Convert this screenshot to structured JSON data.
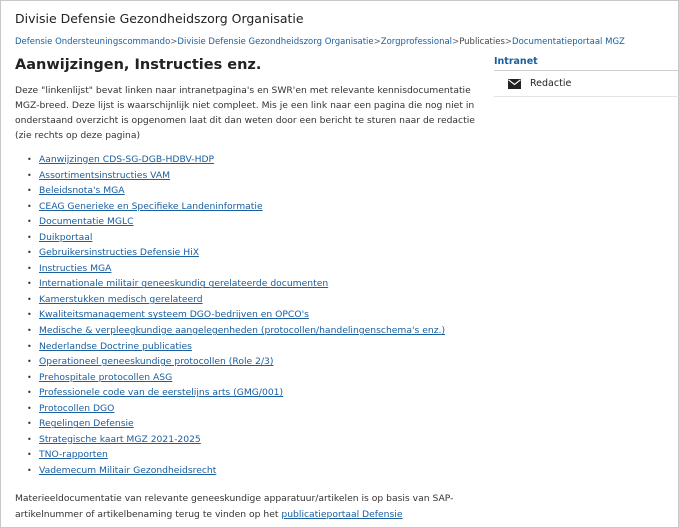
{
  "header": {
    "site_title": "Divisie Defensie Gezondheidszorg Organisatie"
  },
  "breadcrumb": {
    "items": [
      {
        "label": "Defensie Ondersteuningscommando"
      },
      {
        "label": "Divisie Defensie Gezondheidszorg Organisatie"
      },
      {
        "label": "Zorgprofessional"
      },
      {
        "label": "Publicaties"
      },
      {
        "label": "Documentatieportaal MGZ"
      }
    ],
    "separator": ">"
  },
  "main": {
    "title": "Aanwijzingen, Instructies enz.",
    "intro": "Deze \"linkenlijst\" bevat linken naar intranetpagina's en SWR'en met relevante kennisdocumentatie MGZ-breed. Deze lijst is waarschijnlijk niet compleet. Mis je een link naar een pagina die nog niet in onderstaand overzicht is opgenomen laat dit dan weten door een bericht te sturen naar de redactie (zie rechts op deze pagina)",
    "bullet": "•",
    "links": [
      "Aanwijzingen CDS-SG-DGB-HDBV-HDP",
      "Assortimentsinstructies VAM",
      "Beleidsnota's MGA",
      "CEAG Generieke en Specifieke Landeninformatie",
      "Documentatie MGLC",
      "Duikportaal",
      "Gebruikersinstructies Defensie HiX",
      "Instructies MGA",
      "Internationale militair geneeskundig gerelateerde documenten",
      "Kamerstukken medisch gerelateerd",
      "Kwaliteitsmanagement systeem DGO-bedrijven en OPCO's",
      "Medische & verpleegkundige aangelegenheden (protocollen/handelingenschema's enz.)",
      "Nederlandse Doctrine publicaties",
      "Operationeel geneeskundige protocollen (Role 2/3)",
      "Prehospitale protocollen ASG",
      "Professionele code van de eerstelijns arts (GMG/001)",
      "Protocollen DGO",
      "Regelingen Defensie",
      "Strategische kaart MGZ 2021-2025",
      "TNO-rapporten",
      "Vademecum Militair Gezondheidsrecht "
    ],
    "footer_text": "Materieeldocumentatie van relevante geneeskundige apparatuur/artikelen is op basis van SAP-artikelnummer of artikelbenaming terug te vinden op het ",
    "footer_link": "publicatieportaal Defensie"
  },
  "sidebar": {
    "title": "Intranet",
    "items": [
      {
        "label": "Redactie",
        "icon": "envelope-icon"
      }
    ]
  },
  "colors": {
    "link": "#1a5fa0",
    "text": "#333333"
  }
}
